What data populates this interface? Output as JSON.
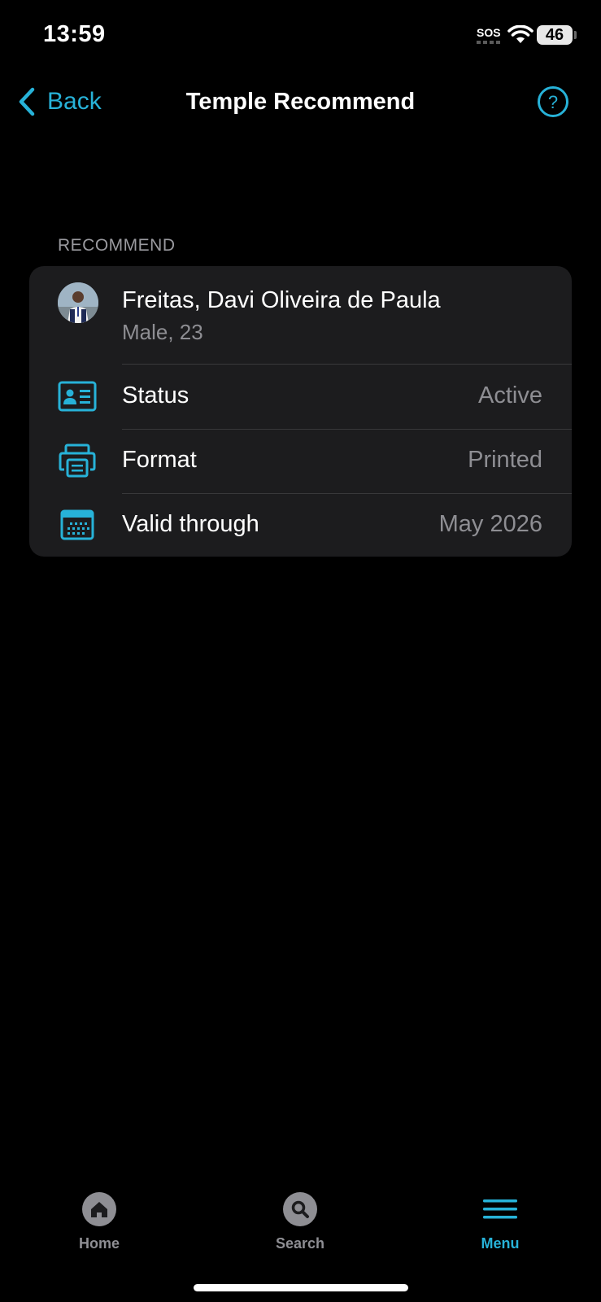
{
  "status_bar": {
    "time": "13:59",
    "sos": "SOS",
    "battery": "46"
  },
  "nav": {
    "back_label": "Back",
    "title": "Temple Recommend",
    "help_icon": "question-circle-icon"
  },
  "section": {
    "header": "RECOMMEND"
  },
  "person": {
    "name": "Freitas, Davi Oliveira de Paula",
    "details": "Male, 23"
  },
  "rows": [
    {
      "icon": "id-card-icon",
      "label": "Status",
      "value": "Active"
    },
    {
      "icon": "printer-icon",
      "label": "Format",
      "value": "Printed"
    },
    {
      "icon": "calendar-icon",
      "label": "Valid through",
      "value": "May 2026"
    }
  ],
  "tabs": [
    {
      "icon": "home-icon",
      "label": "Home"
    },
    {
      "icon": "search-icon",
      "label": "Search"
    },
    {
      "icon": "menu-icon",
      "label": "Menu",
      "active": true
    }
  ],
  "colors": {
    "accent": "#27b2d8",
    "background": "#000000",
    "card": "#1c1c1e",
    "secondary_text": "#8e8e93"
  }
}
